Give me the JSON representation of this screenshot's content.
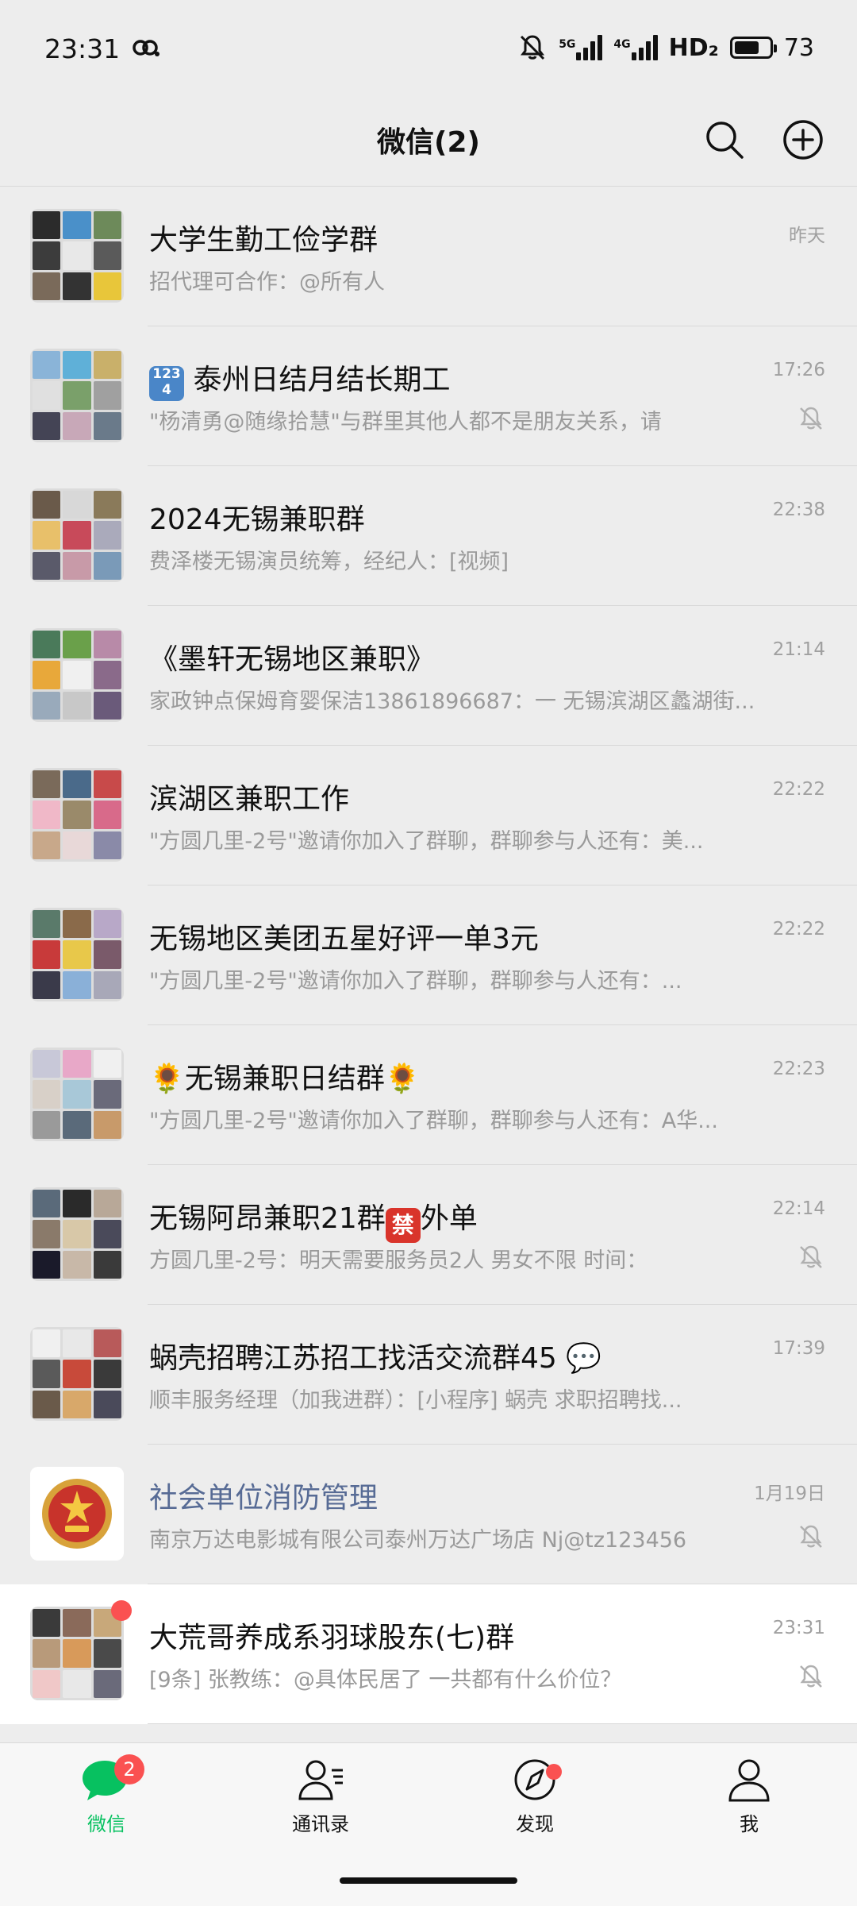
{
  "status_bar": {
    "time": "23:31",
    "battery": "73",
    "network_1": "5G",
    "network_2": "4G",
    "hd": "HD₂"
  },
  "header": {
    "title": "微信(2)"
  },
  "icons": {
    "search": "search-icon",
    "plus": "plus-circle-icon",
    "mute": "bell-off-icon"
  },
  "colors": {
    "accent": "#07c160",
    "badge": "#fa5151",
    "official_name": "#576b95"
  },
  "chats": [
    {
      "name": "大学生勤工俭学群",
      "preview": "招代理可合作：@所有人",
      "time": "昨天",
      "muted": false
    },
    {
      "name_prefix": "1234",
      "name": "泰州日结月结长期工",
      "preview": "\"杨清勇@随缘拾慧\"与群里其他人都不是朋友关系，请",
      "time": "17:26",
      "muted": true
    },
    {
      "name": "2024无锡兼职群",
      "preview": "费泽楼无锡演员统筹，经纪人：[视频]",
      "time": "22:38",
      "muted": false
    },
    {
      "name": "《墨轩无锡地区兼职》",
      "preview": "家政钟点保姆育婴保洁13861896687：一 无锡滨湖区蠡湖街...",
      "time": "21:14",
      "muted": false
    },
    {
      "name": "滨湖区兼职工作",
      "preview": "\"方圆几里-2号\"邀请你加入了群聊，群聊参与人还有：美...",
      "time": "22:22",
      "muted": false
    },
    {
      "name": "无锡地区美团五星好评一单3元",
      "preview": "\"方圆几里-2号\"邀请你加入了群聊，群聊参与人还有：...",
      "time": "22:22",
      "muted": false
    },
    {
      "name_prefix": "🌻",
      "name": "无锡兼职日结群",
      "name_suffix": "🌻",
      "preview": "\"方圆几里-2号\"邀请你加入了群聊，群聊参与人还有：A华...",
      "time": "22:23",
      "muted": false
    },
    {
      "name": "无锡阿昂兼职21群",
      "name_badge": "禁",
      "name_suffix": "外单",
      "preview": "方圆几里-2号：明天需要服务员2人 男女不限 时间：",
      "time": "22:14",
      "muted": true
    },
    {
      "name": "蜗壳招聘江苏招工找活交流群45",
      "name_suffix": "💬",
      "preview": "顺丰服务经理（加我进群）：[小程序] 蜗壳 求职招聘找...",
      "time": "17:39",
      "muted": false
    },
    {
      "name": "社会单位消防管理",
      "preview": "南京万达电影城有限公司泰州万达广场店 Nj@tz123456",
      "time": "1月19日",
      "muted": true,
      "official": true
    },
    {
      "name": "大荒哥养成系羽球股东(七)群",
      "preview": "[9条] 张教练：@具体民居了 一共都有什么价位？",
      "time": "23:31",
      "muted": true,
      "unread": true
    }
  ],
  "nav": {
    "chats": {
      "label": "微信",
      "badge": "2"
    },
    "contacts": {
      "label": "通讯录"
    },
    "discover": {
      "label": "发现"
    },
    "me": {
      "label": "我"
    }
  }
}
